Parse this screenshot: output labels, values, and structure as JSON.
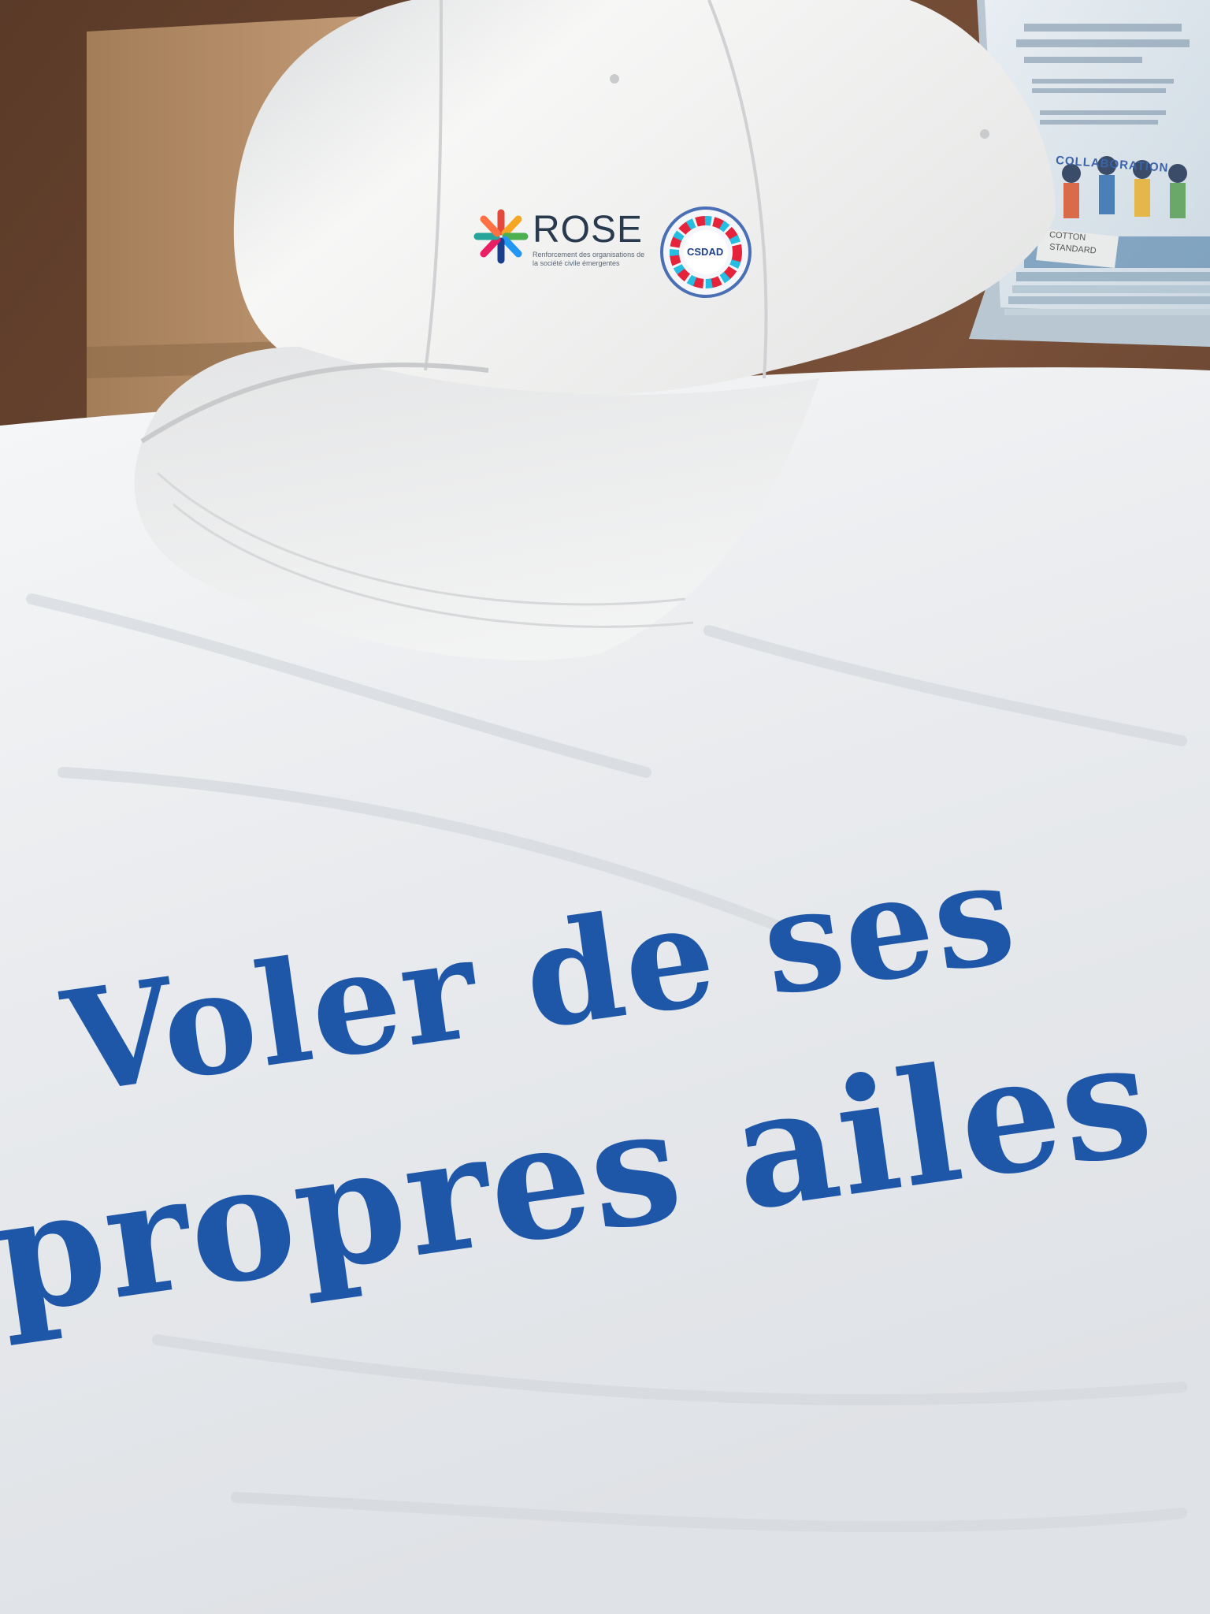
{
  "shirt": {
    "slogan_line_1": "Voler de ses",
    "slogan_line_2": "propres ailes",
    "slogan_color": "#1f57a8"
  },
  "cap": {
    "logo_word": "ROSE",
    "logo_subtitle": "Renforcement des organisations de la société civile émergentes",
    "badge_name": "CSDAD",
    "icons": [
      "rose-logo-icon",
      "csdad-badge-icon"
    ]
  },
  "flyer": {
    "heading": "COLLABORATION",
    "tag_line_1": "COTTON",
    "tag_line_2": "STANDARD"
  },
  "colors": {
    "shirt_white": "#eef0f2",
    "table_wood": "#6b4a35",
    "box_cardboard": "#b08a66"
  }
}
